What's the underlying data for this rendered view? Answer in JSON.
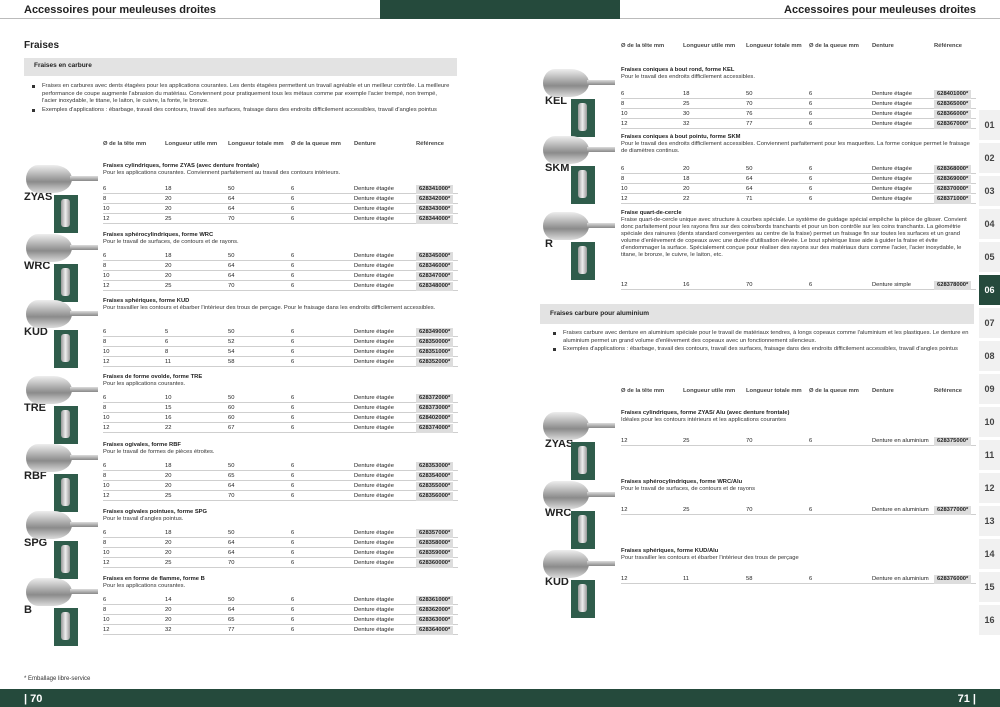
{
  "header": {
    "left_title": "Accessoires pour meuleuses droites",
    "right_title": "Accessoires pour meuleuses droites"
  },
  "footer": {
    "left_page": "| 70",
    "right_page": "71 |",
    "footnote": "* Emballage libre-service"
  },
  "left": {
    "heading": "Fraises",
    "section_title": "Fraises en carbure",
    "bullets": [
      "Fraises en carbures avec dents étagées pour les applications courantes. Les dents étagées permettent un travail agréable et un meilleur contrôle. La meilleure performance de coupe augmente l'abrasion du matériau. Conviennent pour pratiquement tous les métaux comme par exemple l'acier trempé, non trempé, l'acier inoxydable, le titane, le laiton, le cuivre, la fonte, le bronze.",
      "Exemples d'applications : ébarbage, travail des contours, travail des surfaces, fraisage dans des endroits difficilement accessibles, travail d'angles pointus"
    ],
    "columns": [
      "Ø de la tête mm",
      "Longueur utile mm",
      "Longueur totale mm",
      "Ø de la queue mm",
      "Denture",
      "Référence"
    ],
    "products": [
      {
        "code": "ZYAS",
        "title": "Fraises cylindriques, forme ZYAS (avec denture frontale)",
        "desc": "Pour les applications courantes. Conviennent parfaitement au travail des contours intérieurs.",
        "rows": [
          [
            "6",
            "18",
            "50",
            "6",
            "Denture étagée",
            "628341000*"
          ],
          [
            "8",
            "20",
            "64",
            "6",
            "Denture étagée",
            "628342000*"
          ],
          [
            "10",
            "20",
            "64",
            "6",
            "Denture étagée",
            "628343000*"
          ],
          [
            "12",
            "25",
            "70",
            "6",
            "Denture étagée",
            "628344000*"
          ]
        ]
      },
      {
        "code": "WRC",
        "title": "Fraises sphérocylindriques, forme WRC",
        "desc": "Pour le travail de surfaces, de contours et de rayons.",
        "rows": [
          [
            "6",
            "18",
            "50",
            "6",
            "Denture étagée",
            "628345000*"
          ],
          [
            "8",
            "20",
            "64",
            "6",
            "Denture étagée",
            "628346000*"
          ],
          [
            "10",
            "20",
            "64",
            "6",
            "Denture étagée",
            "628347000*"
          ],
          [
            "12",
            "25",
            "70",
            "6",
            "Denture étagée",
            "628348000*"
          ]
        ]
      },
      {
        "code": "KUD",
        "title": "Fraises sphériques, forme KUD",
        "desc": "Pour travailler les contours et ébarber l'intérieur des trous de perçage. Pour le fraisage dans les endroits difficilement accessibles.",
        "rows": [
          [
            "6",
            "5",
            "50",
            "6",
            "Denture étagée",
            "628349000*"
          ],
          [
            "8",
            "6",
            "52",
            "6",
            "Denture étagée",
            "628350000*"
          ],
          [
            "10",
            "8",
            "54",
            "6",
            "Denture étagée",
            "628351000*"
          ],
          [
            "12",
            "11",
            "58",
            "6",
            "Denture étagée",
            "628352000*"
          ]
        ]
      },
      {
        "code": "TRE",
        "title": "Fraises de forme ovoïde, forme TRE",
        "desc": "Pour les applications courantes.",
        "rows": [
          [
            "6",
            "10",
            "50",
            "6",
            "Denture étagée",
            "628372000*"
          ],
          [
            "8",
            "15",
            "60",
            "6",
            "Denture étagée",
            "628373000*"
          ],
          [
            "10",
            "16",
            "60",
            "6",
            "Denture étagée",
            "628402000*"
          ],
          [
            "12",
            "22",
            "67",
            "6",
            "Denture étagée",
            "628374000*"
          ]
        ]
      },
      {
        "code": "RBF",
        "title": "Fraises ogivales, forme RBF",
        "desc": "Pour le travail de formes de pièces étroites.",
        "rows": [
          [
            "6",
            "18",
            "50",
            "6",
            "Denture étagée",
            "628353000*"
          ],
          [
            "8",
            "20",
            "65",
            "6",
            "Denture étagée",
            "628354000*"
          ],
          [
            "10",
            "20",
            "64",
            "6",
            "Denture étagée",
            "628355000*"
          ],
          [
            "12",
            "25",
            "70",
            "6",
            "Denture étagée",
            "628356000*"
          ]
        ]
      },
      {
        "code": "SPG",
        "title": "Fraises ogivales pointues, forme SPG",
        "desc": "Pour le travail d'angles pointus.",
        "rows": [
          [
            "6",
            "18",
            "50",
            "6",
            "Denture étagée",
            "628357000*"
          ],
          [
            "8",
            "20",
            "64",
            "6",
            "Denture étagée",
            "628358000*"
          ],
          [
            "10",
            "20",
            "64",
            "6",
            "Denture étagée",
            "628359000*"
          ],
          [
            "12",
            "25",
            "70",
            "6",
            "Denture étagée",
            "628360000*"
          ]
        ]
      },
      {
        "code": "B",
        "title": "Fraises en forme de flamme, forme B",
        "desc": "Pour les applications courantes.",
        "rows": [
          [
            "6",
            "14",
            "50",
            "6",
            "Denture étagée",
            "628361000*"
          ],
          [
            "8",
            "20",
            "64",
            "6",
            "Denture étagée",
            "628362000*"
          ],
          [
            "10",
            "20",
            "65",
            "6",
            "Denture étagée",
            "628363000*"
          ],
          [
            "12",
            "32",
            "77",
            "6",
            "Denture étagée",
            "628364000*"
          ]
        ]
      }
    ]
  },
  "right": {
    "columns": [
      "Ø de la tête mm",
      "Longueur utile mm",
      "Longueur totale mm",
      "Ø de la queue mm",
      "Denture",
      "Référence"
    ],
    "products": [
      {
        "code": "KEL",
        "title": "Fraises coniques à bout rond, forme KEL",
        "desc": "Pour le travail des endroits difficilement accessibles.",
        "rows": [
          [
            "6",
            "18",
            "50",
            "6",
            "Denture étagée",
            "628401000*"
          ],
          [
            "8",
            "25",
            "70",
            "6",
            "Denture étagée",
            "628365000*"
          ],
          [
            "10",
            "30",
            "76",
            "6",
            "Denture étagée",
            "628366000*"
          ],
          [
            "12",
            "32",
            "77",
            "6",
            "Denture étagée",
            "628367000*"
          ]
        ]
      },
      {
        "code": "SKM",
        "title": "Fraises coniques à bout pointu, forme SKM",
        "desc": "Pour le travail des endroits difficilement accessibles. Conviennent parfaitement pour les maquettes. La forme conique permet le fraisage de diamètres continus.",
        "rows": [
          [
            "6",
            "20",
            "50",
            "6",
            "Denture étagée",
            "628368000*"
          ],
          [
            "8",
            "18",
            "64",
            "6",
            "Denture étagée",
            "628369000*"
          ],
          [
            "10",
            "20",
            "64",
            "6",
            "Denture étagée",
            "628370000*"
          ],
          [
            "12",
            "22",
            "71",
            "6",
            "Denture étagée",
            "628371000*"
          ]
        ]
      },
      {
        "code": "R",
        "title": "Fraise quart-de-cercle",
        "desc": "Fraise quart-de-cercle unique avec structure à courbes spéciale. Le système de guidage spécial empêche la pièce de glisser. Convient donc parfaitement pour les rayons fins sur des coins/bords tranchants et pour un bon contrôle sur les coins tranchants. La géométrie spéciale des rainures (dents standard convergentes au centre de la fraise) permet un fraisage fin sur toutes les surfaces et un grand volume d'enlèvement de copeaux avec une durée d'utilisation élevée. Le bout sphérique lisse aide à guider la fraise et évite d'endommager la surface. Spécialement conçue pour réaliser des rayons sur des matériaux durs comme l'acier, l'acier inoxydable, le titane, le bronze, le cuivre, le laiton, etc.",
        "rows": [
          [
            "12",
            "16",
            "70",
            "6",
            "Denture simple",
            "628378000*"
          ]
        ]
      }
    ],
    "alu_section_title": "Fraises carbure pour aluminium",
    "alu_bullets": [
      "Fraises carbure avec denture en aluminium spéciale pour le travail de matériaux tendres, à longs copeaux comme l'aluminium et les plastiques. Le denture en aluminium permet un grand volume d'enlèvement des copeaux avec un fonctionnement silencieux.",
      "Exemples d'applications : ébarbage, travail des contours, travail des surfaces, fraisage dans des endroits difficilement accessibles, travail d'angles pointus"
    ],
    "alu_products": [
      {
        "code": "ZYAS",
        "title": "Fraises cylindriques, forme ZYAS/ Alu (avec denture frontale)",
        "desc": "Idéales pour les contours intérieurs et les applications courantes",
        "rows": [
          [
            "12",
            "25",
            "70",
            "6",
            "Denture en aluminium",
            "628375000*"
          ]
        ]
      },
      {
        "code": "WRC",
        "title": "Fraises sphérocylindriques, forme WRC/Alu",
        "desc": "Pour le travail de surfaces, de contours et de rayons",
        "rows": [
          [
            "12",
            "25",
            "70",
            "6",
            "Denture en aluminium",
            "628377000*"
          ]
        ]
      },
      {
        "code": "KUD",
        "title": "Fraises sphériques, forme KUD/Alu",
        "desc": "Pour travailler les contours et ébarber l'intérieur des trous de perçage",
        "rows": [
          [
            "12",
            "11",
            "58",
            "6",
            "Denture en aluminium",
            "628376000*"
          ]
        ]
      }
    ]
  },
  "tabs": [
    "01",
    "02",
    "03",
    "04",
    "05",
    "06",
    "07",
    "08",
    "09",
    "10",
    "11",
    "12",
    "13",
    "14",
    "15",
    "16"
  ],
  "active_tab": "06"
}
